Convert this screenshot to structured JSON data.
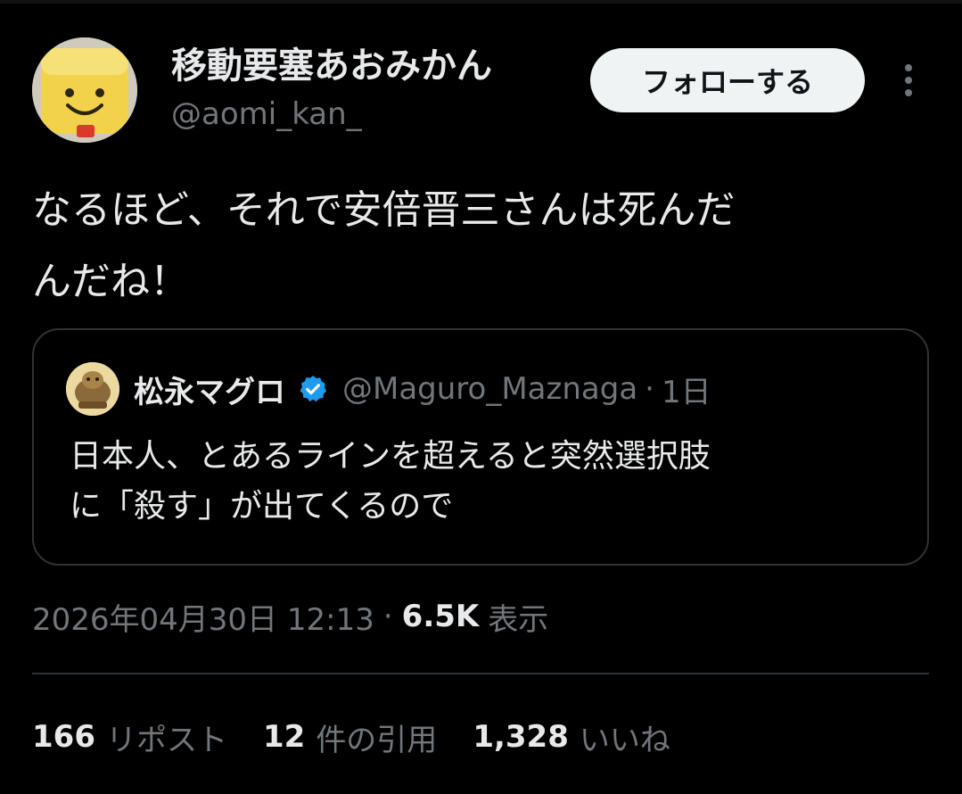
{
  "author": {
    "display_name": "移動要塞あおみかん",
    "handle": "@aomi_kan_",
    "avatar_icon": "avatar-yellow-smiley-face"
  },
  "actions": {
    "follow_label": "フォローする",
    "more_icon": "more-vertical-icon"
  },
  "tweet": {
    "text_line1": "なるほど、それで安倍晋三さんは死んだ",
    "text_line2": "んだね！"
  },
  "quote": {
    "display_name": "松永マグロ",
    "verified_color": "#1d9bf0",
    "handle": "@Maguro_Maznaga",
    "separator": "·",
    "time": "1日",
    "text_line1": "日本人、とあるラインを超えると突然選択肢",
    "text_line2": "に「殺す」が出てくるので"
  },
  "meta": {
    "timestamp": "2026年04月30日 12:13",
    "separator": "·",
    "views_count": "6.5K",
    "views_label": "表示"
  },
  "stats": [
    {
      "count": "166",
      "label": "リポスト"
    },
    {
      "count": "12",
      "label": "件の引用"
    },
    {
      "count": "1,328",
      "label": "いいね"
    }
  ],
  "colors": {
    "background": "#000000",
    "text_primary": "#e7e9ea",
    "text_secondary": "#71767b",
    "border": "#2f3336",
    "follow_bg": "#eff3f4",
    "verified": "#1d9bf0"
  }
}
